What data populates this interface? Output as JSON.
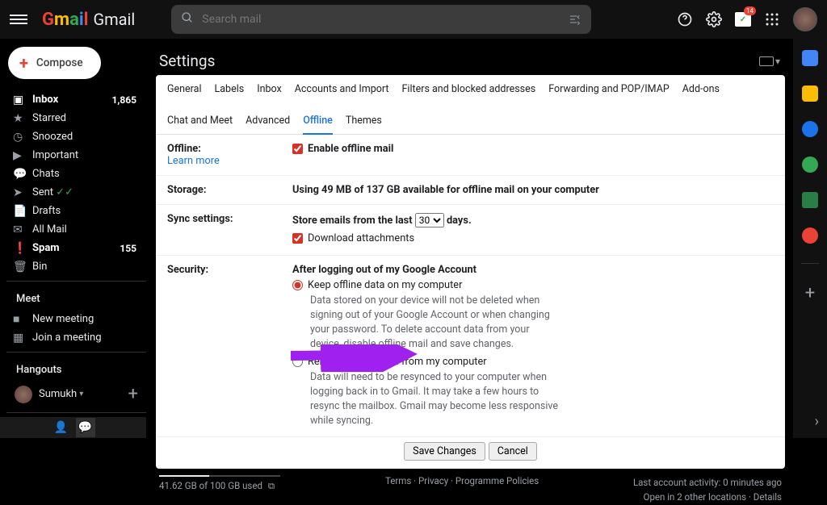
{
  "app": {
    "name": "Gmail"
  },
  "search": {
    "placeholder": "Search mail"
  },
  "compose": "Compose",
  "nav": [
    {
      "icon": "inbox",
      "label": "Inbox",
      "count": "1,865",
      "bold": true
    },
    {
      "icon": "star",
      "label": "Starred",
      "count": "",
      "bold": false
    },
    {
      "icon": "clock",
      "label": "Snoozed",
      "count": "",
      "bold": false
    },
    {
      "icon": "arrow",
      "label": "Important",
      "count": "",
      "bold": false
    },
    {
      "icon": "chat",
      "label": "Chats",
      "count": "",
      "bold": false
    },
    {
      "icon": "send",
      "label": "Sent",
      "count": "",
      "bold": false
    },
    {
      "icon": "file",
      "label": "Drafts",
      "count": "",
      "bold": false
    },
    {
      "icon": "mail",
      "label": "All Mail",
      "count": "",
      "bold": false
    },
    {
      "icon": "spam",
      "label": "Spam",
      "count": "155",
      "bold": true
    },
    {
      "icon": "bin",
      "label": "Bin",
      "count": "",
      "bold": false
    }
  ],
  "meet": {
    "header": "Meet",
    "new": "New meeting",
    "join": "Join a meeting"
  },
  "hangouts": {
    "header": "Hangouts",
    "user": "Sumukh"
  },
  "page_title": "Settings",
  "keyboard_indicator": "▾",
  "tabs": [
    "General",
    "Labels",
    "Inbox",
    "Accounts and Import",
    "Filters and blocked addresses",
    "Forwarding and POP/IMAP",
    "Add-ons",
    "Chat and Meet",
    "Advanced",
    "Offline",
    "Themes"
  ],
  "active_tab": "Offline",
  "offline": {
    "section": "Offline:",
    "learn": "Learn more",
    "enable": "Enable offline mail",
    "storage_label": "Storage:",
    "storage_text": "Using 49 MB of 137 GB available for offline mail on your computer",
    "sync_label": "Sync settings:",
    "sync_text_pre": "Store emails from the last",
    "sync_days": "30",
    "sync_text_post": "days.",
    "download": "Download attachments",
    "security_label": "Security:",
    "after_logout": "After logging out of my Google Account",
    "keep": "Keep offline data on my computer",
    "keep_desc": "Data stored on your device will not be deleted when signing out of your Google Account or when changing your password. To delete account data from your device, disable offline mail and save changes.",
    "remove": "Remove offline data from my computer",
    "remove_desc": "Data will need to be resynced to your computer when logging back in to Gmail. It may take a few hours to resync the mailbox. Gmail may become less responsive while syncing."
  },
  "buttons": {
    "save": "Save Changes",
    "cancel": "Cancel"
  },
  "footer": {
    "storage": "41.62 GB of 100 GB used",
    "storage_pct": 41.6,
    "terms": "Terms",
    "privacy": "Privacy",
    "policies": "Programme Policies",
    "activity": "Last account activity: 0 minutes ago",
    "open": "Open in 2 other locations",
    "details": "Details"
  },
  "rail_colors": [
    "#4285f4",
    "#fbbc04",
    "#1a73e8",
    "#34a853",
    "#ea4335",
    "#c5221f"
  ]
}
